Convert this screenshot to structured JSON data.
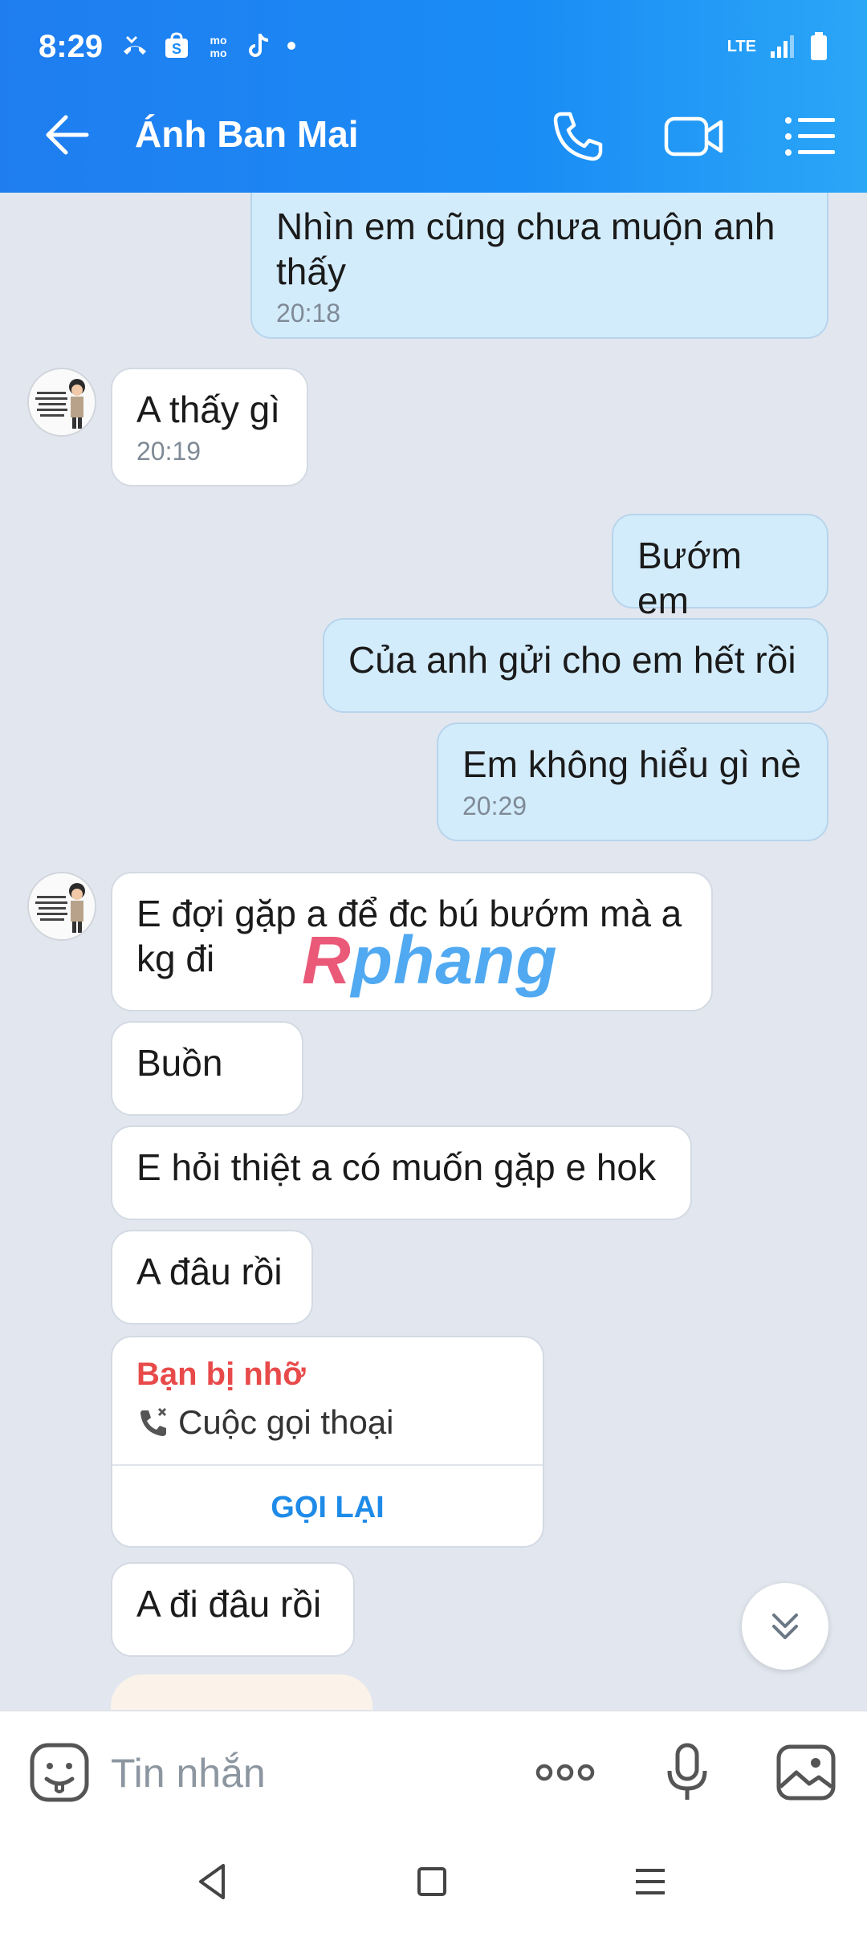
{
  "status": {
    "time": "8:29",
    "network": "LTE"
  },
  "header": {
    "contact_name": "Ánh Ban Mai"
  },
  "messages": [
    {
      "dir": "out",
      "text": "Nhìn em  cũng chưa muộn anh thấy",
      "time": "20:18"
    },
    {
      "dir": "in",
      "text": "A thấy gì",
      "time": "20:19"
    },
    {
      "dir": "out",
      "text": "Bướm em"
    },
    {
      "dir": "out",
      "text": "Của anh gửi cho em hết rồi"
    },
    {
      "dir": "out",
      "text": "Em không hiểu gì nè",
      "time": "20:29"
    },
    {
      "dir": "in",
      "text": "E đợi gặp a để đc bú bướm mà a kg đi"
    },
    {
      "dir": "in",
      "text": "Buồn"
    },
    {
      "dir": "in",
      "text": "E hỏi thiệt a có muốn gặp e hok"
    },
    {
      "dir": "in",
      "text": "A đâu rồi"
    },
    {
      "dir": "in",
      "text": "A đi đâu rồi"
    }
  ],
  "missed_call": {
    "title": "Bạn bị nhỡ",
    "subtitle": "Cuộc gọi thoại",
    "callback_label": "GỌI LẠI"
  },
  "watermark": {
    "first": "R",
    "rest": "phang"
  },
  "input": {
    "placeholder": "Tin nhắn"
  },
  "colors": {
    "header_blue": "#1a8cf5",
    "outgoing_bubble": "#d3ecfc",
    "incoming_bubble": "#ffffff",
    "missed_red": "#e84a4a",
    "callback_blue": "#1f8be8"
  }
}
